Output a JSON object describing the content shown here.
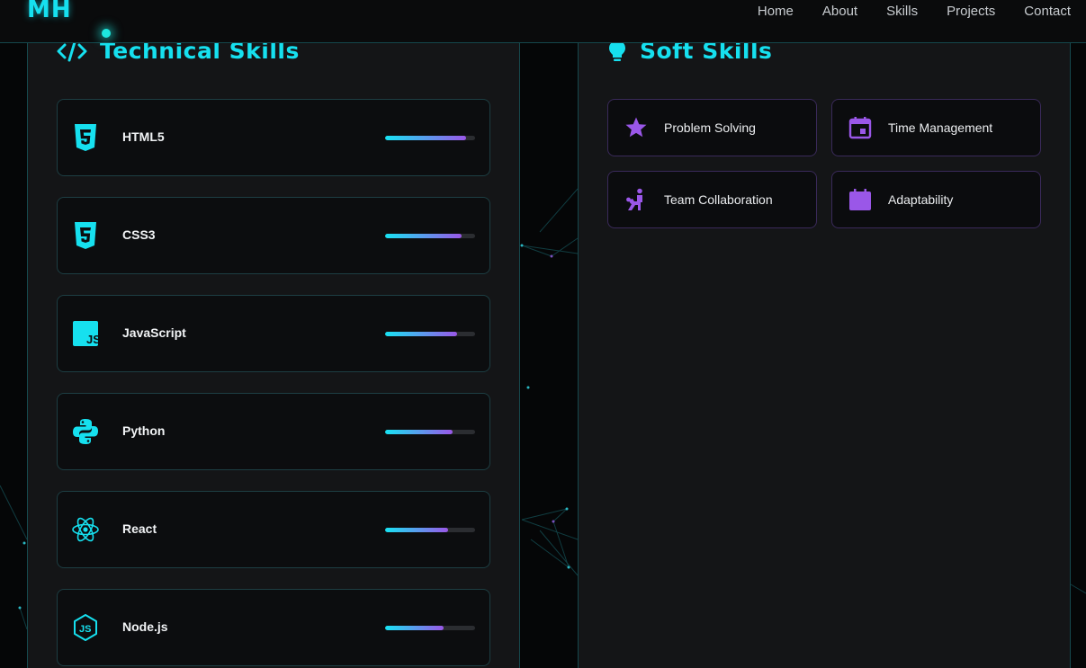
{
  "header": {
    "logo": "MH",
    "nav": [
      "Home",
      "About",
      "Skills",
      "Projects",
      "Contact"
    ]
  },
  "technical": {
    "title": "Technical Skills",
    "skills": [
      {
        "name": "HTML5",
        "icon": "html5-icon",
        "level": 0.9
      },
      {
        "name": "CSS3",
        "icon": "css3-icon",
        "level": 0.85
      },
      {
        "name": "JavaScript",
        "icon": "javascript-icon",
        "level": 0.8
      },
      {
        "name": "Python",
        "icon": "python-icon",
        "level": 0.75
      },
      {
        "name": "React",
        "icon": "react-icon",
        "level": 0.7
      },
      {
        "name": "Node.js",
        "icon": "nodejs-icon",
        "level": 0.65
      }
    ]
  },
  "soft": {
    "title": "Soft Skills",
    "skills": [
      {
        "name": "Problem Solving",
        "icon": "star-icon"
      },
      {
        "name": "Time Management",
        "icon": "calendar-icon"
      },
      {
        "name": "Team Collaboration",
        "icon": "team-icon"
      },
      {
        "name": "Adaptability",
        "icon": "calendar-blank-icon"
      }
    ]
  },
  "colors": {
    "accent": "#16e0ef",
    "purple": "#9a57e8"
  }
}
